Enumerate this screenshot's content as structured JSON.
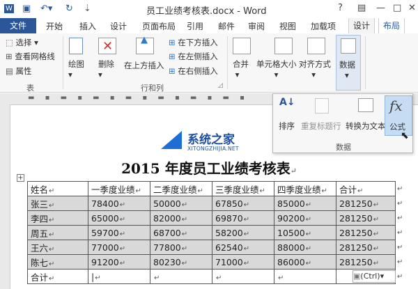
{
  "window": {
    "title": "员工业绩考核表.docx - Word",
    "help": "?",
    "min": "—",
    "max": "□",
    "close": "✕"
  },
  "qat": {
    "save_icon": "save-icon",
    "undo_icon": "undo-icon",
    "redo_icon": "redo-icon"
  },
  "tabs": [
    "文件",
    "开始",
    "插入",
    "设计",
    "页面布局",
    "引用",
    "邮件",
    "审阅",
    "视图",
    "加载项",
    "设计",
    "布局"
  ],
  "ribbon": {
    "table_group": {
      "select": "选择",
      "gridlines": "查看网格线",
      "properties": "属性",
      "label": "表"
    },
    "draw": "绘图",
    "delete": "删除",
    "insert_above": "在上方插入",
    "insert_below": "在下方插入",
    "insert_left": "在左侧插入",
    "insert_right": "在右侧插入",
    "rows_cols_label": "行和列",
    "merge": "合并",
    "cell_size": "单元格大小",
    "alignment": "对齐方式",
    "data": "数据"
  },
  "data_popup": {
    "sort": "排序",
    "repeat_header": "重复标题行",
    "convert_text": "转换为文本",
    "formula": "公式",
    "formula_glyph": "fx",
    "label": "数据"
  },
  "watermark": {
    "name": "系统之家",
    "url": "XITONGZHIJIA.NET"
  },
  "document": {
    "heading": "2015 年度员工业绩考核表",
    "headers": [
      "姓名",
      "一季度业绩",
      "二季度业绩",
      "三季度业绩",
      "四季度业绩",
      "合计"
    ],
    "rows": [
      [
        "张三",
        "78400",
        "50000",
        "67850",
        "85000",
        "281250"
      ],
      [
        "李四",
        "65000",
        "82000",
        "69870",
        "90200",
        "281250"
      ],
      [
        "周五",
        "59700",
        "68700",
        "58200",
        "10500",
        "281250"
      ],
      [
        "王六",
        "77000",
        "77800",
        "62540",
        "88000",
        "281250"
      ],
      [
        "陈七",
        "91200",
        "80230",
        "71000",
        "86000",
        "281250"
      ],
      [
        "合计",
        "",
        "",
        "",
        "",
        ""
      ]
    ],
    "paste_tag": "(Ctrl)"
  }
}
